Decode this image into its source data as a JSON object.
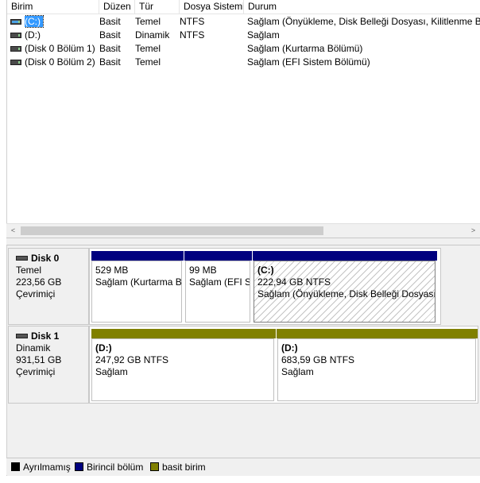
{
  "columns": [
    "Birim",
    "Düzen",
    "Tür",
    "Dosya Sistemi",
    "Durum"
  ],
  "volumes": [
    {
      "name": "(C:)",
      "layout": "Basit",
      "type": "Temel",
      "fs": "NTFS",
      "status": "Sağlam (Önyükleme, Disk Belleği Dosyası, Kilitlenme Bi"
    },
    {
      "name": "(D:)",
      "layout": "Basit",
      "type": "Dinamik",
      "fs": "NTFS",
      "status": "Sağlam"
    },
    {
      "name": "(Disk 0 Bölüm 1)",
      "layout": "Basit",
      "type": "Temel",
      "fs": "",
      "status": "Sağlam (Kurtarma Bölümü)"
    },
    {
      "name": "(Disk 0 Bölüm 2)",
      "layout": "Basit",
      "type": "Temel",
      "fs": "",
      "status": "Sağlam (EFI Sistem Bölümü)"
    }
  ],
  "scroll": {
    "left_arrow": "<",
    "right_arrow": ">"
  },
  "disks": [
    {
      "title": "Disk 0",
      "kind": "Temel",
      "size": "223,56 GB",
      "state": "Çevrimiçi",
      "partitions": [
        {
          "label": "",
          "size": "529 MB",
          "status": "Sağlam (Kurtarma B"
        },
        {
          "label": "",
          "size": "99 MB",
          "status": "Sağlam (EFI S"
        },
        {
          "label": "(C:)",
          "size": "222,94 GB NTFS",
          "status": "Sağlam (Önyükleme, Disk Belleği Dosyası,"
        }
      ]
    },
    {
      "title": "Disk 1",
      "kind": "Dinamik",
      "size": "931,51 GB",
      "state": "Çevrimiçi",
      "partitions": [
        {
          "label": "(D:)",
          "size": "247,92 GB NTFS",
          "status": "Sağlam"
        },
        {
          "label": "(D:)",
          "size": "683,59 GB NTFS",
          "status": "Sağlam"
        }
      ]
    }
  ],
  "legend": [
    {
      "label": "Ayrılmamış",
      "color": "#000000"
    },
    {
      "label": "Birincil bölüm",
      "color": "#00007f"
    },
    {
      "label": "basit birim",
      "color": "#808000"
    }
  ],
  "colors": {
    "primary": "#00007f",
    "simple": "#808000",
    "selection": "#3399ff"
  }
}
